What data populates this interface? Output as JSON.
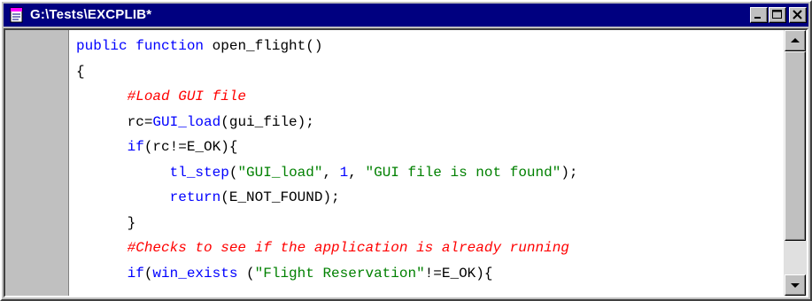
{
  "window": {
    "title": "G:\\Tests\\EXCPLIB*"
  },
  "colors": {
    "titlebar": "#000080",
    "keyword": "#0000ff",
    "comment": "#ff0000",
    "string": "#008000",
    "code_background": "#ffffff",
    "chrome": "#c0c0c0"
  },
  "icons": {
    "app": "document-icon",
    "minimize": "minimize-icon",
    "maximize": "maximize-icon",
    "close": "close-icon",
    "scroll_up": "arrow-up-icon",
    "scroll_down": "arrow-down-icon"
  },
  "editor": {
    "lines": [
      [
        {
          "t": "kw",
          "s": "public"
        },
        {
          "t": "pl",
          "s": " "
        },
        {
          "t": "kw",
          "s": "function"
        },
        {
          "t": "pl",
          "s": " open_flight()"
        }
      ],
      [
        {
          "t": "pl",
          "s": "{"
        }
      ],
      [
        {
          "t": "pl",
          "s": "      "
        },
        {
          "t": "comment",
          "s": "#Load GUI file"
        }
      ],
      [
        {
          "t": "pl",
          "s": "      rc="
        },
        {
          "t": "kw",
          "s": "GUI_load"
        },
        {
          "t": "pl",
          "s": "(gui_file);"
        }
      ],
      [
        {
          "t": "pl",
          "s": "      "
        },
        {
          "t": "kw",
          "s": "if"
        },
        {
          "t": "pl",
          "s": "(rc!=E_OK){"
        }
      ],
      [
        {
          "t": "pl",
          "s": "           "
        },
        {
          "t": "kw",
          "s": "tl_step"
        },
        {
          "t": "pl",
          "s": "("
        },
        {
          "t": "str",
          "s": "\"GUI_load\""
        },
        {
          "t": "pl",
          "s": ", "
        },
        {
          "t": "kw",
          "s": "1"
        },
        {
          "t": "pl",
          "s": ", "
        },
        {
          "t": "str",
          "s": "\"GUI file is not found\""
        },
        {
          "t": "pl",
          "s": ");"
        }
      ],
      [
        {
          "t": "pl",
          "s": "           "
        },
        {
          "t": "kw",
          "s": "return"
        },
        {
          "t": "pl",
          "s": "(E_NOT_FOUND);"
        }
      ],
      [
        {
          "t": "pl",
          "s": "      }"
        }
      ],
      [
        {
          "t": "pl",
          "s": "      "
        },
        {
          "t": "comment",
          "s": "#Checks to see if the application is already running"
        }
      ],
      [
        {
          "t": "pl",
          "s": "      "
        },
        {
          "t": "kw",
          "s": "if"
        },
        {
          "t": "pl",
          "s": "("
        },
        {
          "t": "kw",
          "s": "win_exists"
        },
        {
          "t": "pl",
          "s": " ("
        },
        {
          "t": "str",
          "s": "\"Flight Reservation\""
        },
        {
          "t": "pl",
          "s": "!=E_OK){"
        }
      ]
    ]
  }
}
